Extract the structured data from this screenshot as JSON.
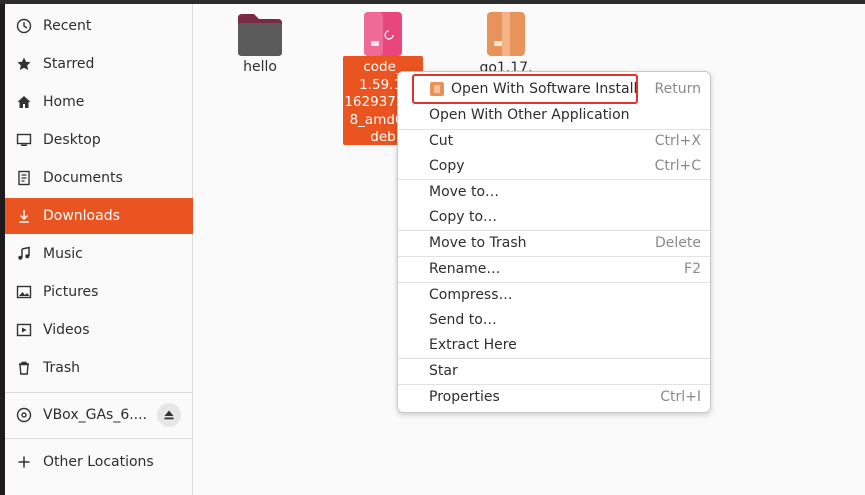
{
  "sidebar": {
    "items": [
      {
        "label": "Recent",
        "icon": "clock-icon"
      },
      {
        "label": "Starred",
        "icon": "star-icon"
      },
      {
        "label": "Home",
        "icon": "home-icon"
      },
      {
        "label": "Desktop",
        "icon": "desktop-icon"
      },
      {
        "label": "Documents",
        "icon": "document-icon"
      },
      {
        "label": "Downloads",
        "icon": "download-icon",
        "active": true
      },
      {
        "label": "Music",
        "icon": "music-icon"
      },
      {
        "label": "Pictures",
        "icon": "picture-icon"
      },
      {
        "label": "Videos",
        "icon": "video-icon"
      },
      {
        "label": "Trash",
        "icon": "trash-icon"
      }
    ],
    "device": {
      "label": "VBox_GAs_6....",
      "icon": "disc-icon",
      "eject_icon": "eject-icon"
    },
    "other": {
      "label": "Other Locations",
      "icon": "plus-icon"
    }
  },
  "files": [
    {
      "name": "hello",
      "type": "folder"
    },
    {
      "name": "code_1.59.1-1629375198_amd64.deb",
      "lines": [
        "code_",
        "1.59.1-",
        "162937519",
        "8_amd64.",
        "deb"
      ],
      "selected": true
    },
    {
      "name": "go1.17.",
      "type": "package"
    }
  ],
  "context_menu": {
    "items": [
      {
        "label": "Open With Software Install",
        "accel": "Return",
        "highlighted": true,
        "icon": "package-icon"
      },
      {
        "label": "Open With Other Application",
        "accel": ""
      },
      {
        "label": "Cut",
        "accel": "Ctrl+X"
      },
      {
        "label": "Copy",
        "accel": "Ctrl+C"
      },
      {
        "label": "Move to…",
        "accel": ""
      },
      {
        "label": "Copy to…",
        "accel": ""
      },
      {
        "label": "Move to Trash",
        "accel": "Delete"
      },
      {
        "label": "Rename…",
        "accel": "F2"
      },
      {
        "label": "Compress…",
        "accel": ""
      },
      {
        "label": "Send to…",
        "accel": ""
      },
      {
        "label": "Extract Here",
        "accel": ""
      },
      {
        "label": "Star",
        "accel": ""
      },
      {
        "label": "Properties",
        "accel": "Ctrl+I"
      }
    ]
  },
  "colors": {
    "accent": "#e95420",
    "highlight_border": "#e0322f"
  }
}
